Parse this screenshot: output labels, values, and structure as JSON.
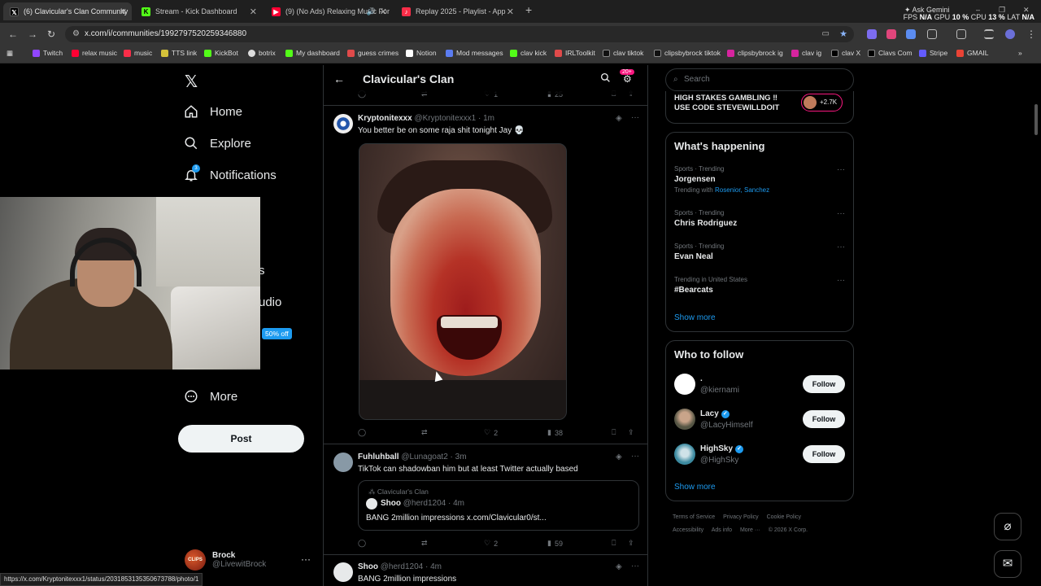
{
  "browser": {
    "tabs": [
      {
        "label": "(6) Clavicular's Clan Community",
        "active": true
      },
      {
        "label": "Stream - Kick Dashboard",
        "active": false
      },
      {
        "label": "(9) (No Ads) Relaxing Music For",
        "active": false
      },
      {
        "label": "Replay 2025 - Playlist - App",
        "active": false
      }
    ],
    "ask_gemini": "Ask Gemini",
    "sysinfo": {
      "fps_label": "FPS",
      "fps": "N/A",
      "gpu_label": "GPU",
      "gpu": "10 %",
      "cpu_label": "CPU",
      "cpu": "13 %",
      "lat_label": "LAT",
      "lat": "N/A"
    },
    "url": "x.com/i/communities/1992797520259346880",
    "bookmarks": [
      "Twitch",
      "relax music",
      "music",
      "TTS link",
      "KickBot",
      "botrix",
      "My dashboard",
      "guess crimes",
      "Notion",
      "Mod messages",
      "clav kick",
      "IRLToolkit",
      "clav tiktok",
      "clipsbybrock tiktok",
      "clipsbybrock ig",
      "clav ig",
      "clav X",
      "Clavs Com",
      "Stripe",
      "GMAIL"
    ],
    "status_url": "https://x.com/Kryptonitexxx1/status/2031853135350673788/photo/1"
  },
  "nav": {
    "items": [
      "Home",
      "Explore",
      "Notifications"
    ],
    "partial_1": "s",
    "partial_2": "udio",
    "badge": "50% off",
    "more": "More",
    "post": "Post",
    "profile_name": "Brock",
    "profile_handle": "@LivewitBrock",
    "notif_count": "3"
  },
  "community": {
    "title": "Clavicular's Clan",
    "notif_badge": "20+"
  },
  "posts": [
    {
      "name": "Kryptonitexxx",
      "handle": "@Kryptonitexxx1",
      "time": "· 1m",
      "text": "You better be on some raja shit tonight Jay 💀",
      "likes": "2",
      "views": "38"
    },
    {
      "name": "Fuhluhball",
      "handle": "@Lunagoat2",
      "time": "· 3m",
      "text": "TikTok can shadowban him but at least Twitter actually based",
      "quote_community": "Clavicular's Clan",
      "quote_name": "Shoo",
      "quote_handle": "@herd1204",
      "quote_time": "· 4m",
      "quote_text": "BANG 2million impressions x.com/Clavicular0/st...",
      "likes": "2",
      "views": "59"
    },
    {
      "name": "Shoo",
      "handle": "@herd1204",
      "time": "· 4m",
      "text": "BANG 2million impressions"
    }
  ],
  "prev_post": {
    "likes": "1",
    "views": "25"
  },
  "right": {
    "search_placeholder": "Search",
    "ad_text_1": "HIGH STAKES GAMBLING ‼",
    "ad_text_2": "USE CODE STEVEWILLDOIT",
    "ad_count": "+2.7K",
    "whats_happening": "What's happening",
    "trends": [
      {
        "meta": "Sports · Trending",
        "name": "Jorgensen",
        "with_label": "Trending with",
        "with": "Rosenior, Sanchez"
      },
      {
        "meta": "Sports · Trending",
        "name": "Chris Rodriguez"
      },
      {
        "meta": "Sports · Trending",
        "name": "Evan Neal"
      },
      {
        "meta": "Trending in United States",
        "name": "#Bearcats"
      }
    ],
    "show_more": "Show more",
    "who_to_follow": "Who to follow",
    "follow_suggestions": [
      {
        "name": ".",
        "handle": "@kiernami",
        "verified": false,
        "follow": "Follow"
      },
      {
        "name": "Lacy",
        "handle": "@LacyHimself",
        "verified": true,
        "follow": "Follow"
      },
      {
        "name": "HighSky",
        "handle": "@HighSky",
        "verified": true,
        "follow": "Follow"
      }
    ],
    "show_more_2": "Show more",
    "footer": [
      "Terms of Service",
      "Privacy Policy",
      "Cookie Policy",
      "Accessibility",
      "Ads info",
      "More ···",
      "© 2026 X Corp."
    ]
  },
  "colors": {
    "accent": "#1d9bf0",
    "background": "#000000",
    "text": "#e7e9ea",
    "muted": "#71767b",
    "border": "#2f3336",
    "pink": "#f91880"
  }
}
